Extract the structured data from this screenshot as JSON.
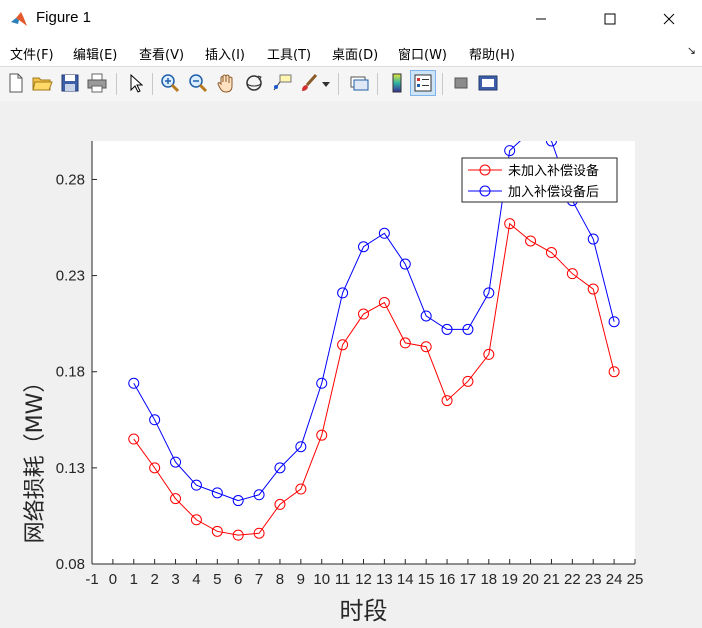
{
  "window": {
    "title": "Figure 1",
    "controls": [
      "minimize",
      "maximize",
      "close"
    ]
  },
  "menu": {
    "items": [
      "文件(F)",
      "编辑(E)",
      "查看(V)",
      "插入(I)",
      "工具(T)",
      "桌面(D)",
      "窗口(W)",
      "帮助(H)"
    ]
  },
  "toolbar": {
    "buttons": [
      "new-figure-icon",
      "open-file-icon",
      "save-icon",
      "print-icon",
      "pointer-icon",
      "zoom-in-icon",
      "zoom-out-icon",
      "pan-hand-icon",
      "rotate-3d-icon",
      "data-cursor-icon",
      "brush-icon",
      "brush-dropdown-icon",
      "link-plot-icon",
      "insert-colorbar-icon",
      "insert-legend-icon",
      "hide-plot-tools-icon",
      "show-plot-tools-icon"
    ]
  },
  "chart_data": {
    "type": "line",
    "xlabel": "时段",
    "ylabel": "网络损耗（MW）",
    "xlim": [
      -1,
      25
    ],
    "ylim": [
      0.08,
      0.3
    ],
    "xticks": [
      "-1",
      "0",
      "1",
      "2",
      "3",
      "4",
      "5",
      "6",
      "7",
      "8",
      "9",
      "10",
      "11",
      "12",
      "13",
      "14",
      "15",
      "16",
      "17",
      "18",
      "19",
      "20",
      "21",
      "22",
      "23",
      "24",
      "25"
    ],
    "yticks": [
      "0.08",
      "0.13",
      "0.18",
      "0.23",
      "0.28"
    ],
    "x": [
      1,
      2,
      3,
      4,
      5,
      6,
      7,
      8,
      9,
      10,
      11,
      12,
      13,
      14,
      15,
      16,
      17,
      18,
      19,
      20,
      21,
      22,
      23,
      24
    ],
    "series": [
      {
        "name": "未加入补偿设备",
        "color": "#ff0000",
        "marker": "circle",
        "values": [
          0.145,
          0.13,
          0.114,
          0.103,
          0.097,
          0.095,
          0.096,
          0.111,
          0.119,
          0.147,
          0.194,
          0.21,
          0.216,
          0.195,
          0.193,
          0.165,
          0.175,
          0.189,
          0.257,
          0.248,
          0.242,
          0.231,
          0.223,
          0.18
        ]
      },
      {
        "name": "加入补偿设备后",
        "color": "#0000ff",
        "marker": "circle",
        "values": [
          0.174,
          0.155,
          0.133,
          0.121,
          0.117,
          0.113,
          0.116,
          0.13,
          0.141,
          0.174,
          0.221,
          0.245,
          0.252,
          0.236,
          0.209,
          0.202,
          0.202,
          0.221,
          0.295,
          0.305,
          0.3,
          0.269,
          0.249,
          0.206
        ]
      }
    ],
    "legend": "top-right",
    "grid": false
  }
}
